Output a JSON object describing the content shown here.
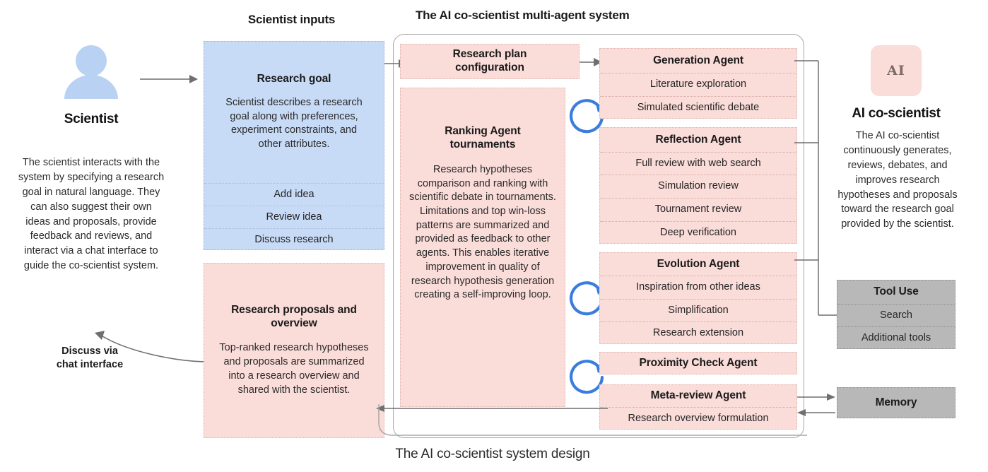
{
  "figure": {
    "caption": "The AI co-scientist system design",
    "headings": {
      "scientist_inputs": "Scientist inputs",
      "multi_agent_system": "The AI co-scientist multi-agent system"
    }
  },
  "scientist": {
    "icon": "person-icon",
    "label": "Scientist",
    "description": "The scientist interacts with the system by specifying a research goal in natural language. They can also suggest their own ideas and proposals, provide feedback and reviews, and interact via a chat interface to guide the co-scientist system.",
    "feedback_arrow_label": "Discuss via\nchat interface",
    "feedback_arrow_line1": "Discuss via",
    "feedback_arrow_line2": "chat interface"
  },
  "inputs_panel": {
    "title": "Research goal",
    "body": "Scientist describes a research goal along with preferences, experiment constraints, and other attributes.",
    "rows": [
      "Add idea",
      "Review idea",
      "Discuss research"
    ]
  },
  "outputs_panel": {
    "title": "Research proposals and overview",
    "body": "Top-ranked research hypotheses and proposals are summarized into a research overview and shared with the scientist."
  },
  "system": {
    "research_plan": {
      "title_line1": "Research plan",
      "title_line2": "configuration"
    },
    "ranking": {
      "title_line1": "Ranking Agent",
      "title_line2": "tournaments",
      "body": "Research hypotheses comparison and ranking with scientific debate in tournaments. Limitations and top win-loss patterns are summarized and provided as feedback to other agents. This enables iterative improvement in quality of research hypothesis generation creating a self-improving  loop."
    },
    "agents": [
      {
        "name": "Generation Agent",
        "rows": [
          "Literature exploration",
          "Simulated scientific debate"
        ]
      },
      {
        "name": "Reflection Agent",
        "rows": [
          "Full review with web search",
          "Simulation review",
          "Tournament review",
          "Deep verification"
        ]
      },
      {
        "name": "Evolution Agent",
        "rows": [
          "Inspiration from other ideas",
          "Simplification",
          "Research extension"
        ]
      },
      {
        "name": "Proximity Check Agent",
        "rows": []
      },
      {
        "name": "Meta-review Agent",
        "rows": [
          "Research overview formulation"
        ]
      }
    ]
  },
  "right_column": {
    "badge_text": "AI",
    "title": "AI co-scientist",
    "description": "The AI co-scientist continuously generates, reviews, debates, and improves research hypotheses and proposals toward the research goal provided by the scientist.",
    "tool_use": {
      "title": "Tool Use",
      "rows": [
        "Search",
        "Additional tools"
      ]
    },
    "memory": {
      "title": "Memory"
    }
  },
  "colors": {
    "blue_fill": "#c7daf6",
    "pink_fill": "#fadcd9",
    "gray_fill": "#b8b8b8",
    "loop_blue": "#3b7ddd",
    "line_gray": "#8a8a8a",
    "person_blue": "#b9d1f2"
  }
}
